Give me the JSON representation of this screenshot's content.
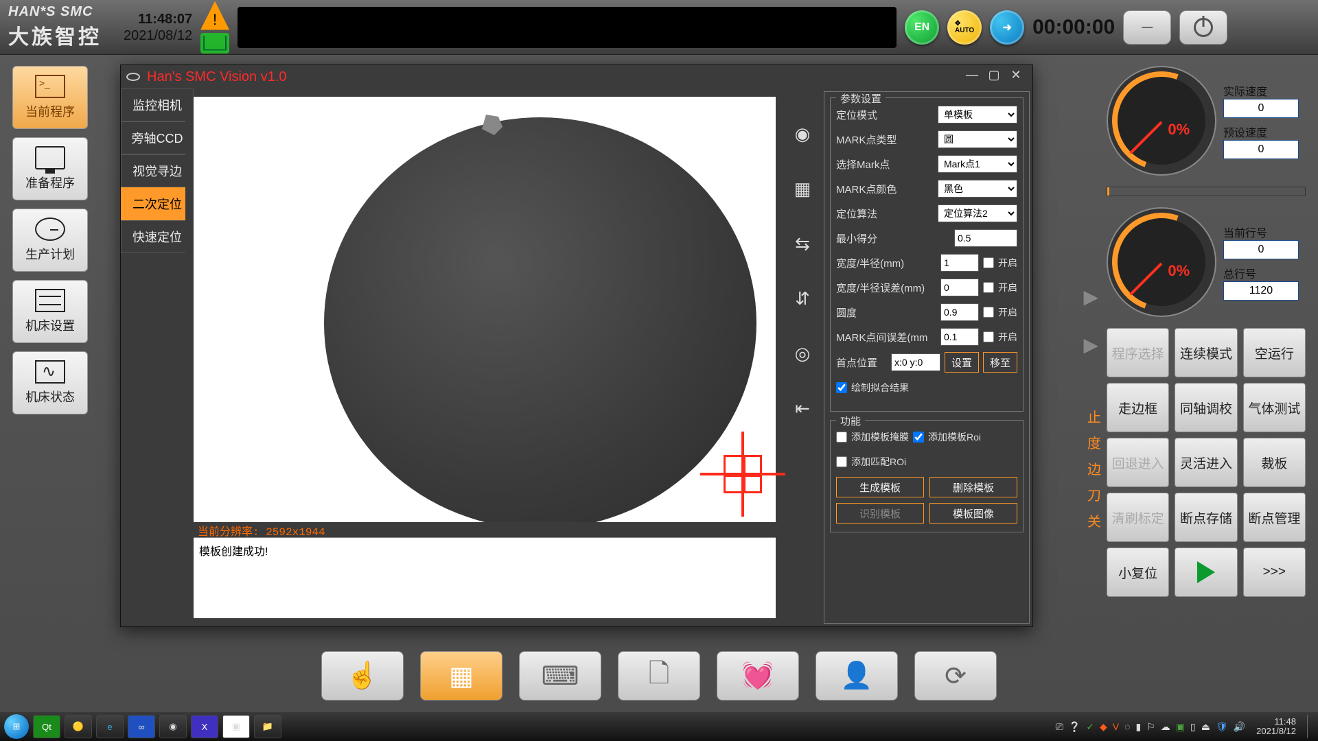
{
  "header": {
    "brand_en": "HAN*S SMC",
    "brand_cn": "大族智控",
    "time": "11:48:07",
    "date": "2021/08/12",
    "lang": "EN",
    "auto": "AUTO",
    "timer": "00:00:00"
  },
  "left_nav": [
    {
      "label": "当前程序",
      "active": true,
      "icon": "term"
    },
    {
      "label": "准备程序",
      "icon": "monitor"
    },
    {
      "label": "生产计划",
      "icon": "clock"
    },
    {
      "label": "机床设置",
      "icon": "sliders"
    },
    {
      "label": "机床状态",
      "icon": "wave"
    }
  ],
  "gauges": {
    "g1": {
      "pct": "0%",
      "fields": [
        {
          "lbl": "实际速度",
          "val": "0"
        },
        {
          "lbl": "预设速度",
          "val": "0"
        }
      ]
    },
    "g2": {
      "pct": "0%",
      "fields": [
        {
          "lbl": "当前行号",
          "val": "0"
        },
        {
          "lbl": "总行号",
          "val": "1120"
        }
      ]
    }
  },
  "btn_grid": [
    "程序选择",
    "连续模式",
    "空运行",
    "走边框",
    "同轴调校",
    "气体测试",
    "回退进入",
    "灵活进入",
    "裁板",
    "清刷标定",
    "断点存储",
    "断点管理",
    "小复位",
    "PLAY",
    ">>>"
  ],
  "btn_grid_disabled": [
    0,
    6,
    9
  ],
  "vision": {
    "title": "Han's SMC Vision v1.0",
    "tabs": [
      "监控相机",
      "旁轴CCD",
      "视觉寻边",
      "二次定位",
      "快速定位"
    ],
    "active_tab": 3,
    "resolution_label": "当前分辨率: 2592x1944",
    "log": "模板创建成功!",
    "params": {
      "legend": "参数设置",
      "locate_mode": {
        "lbl": "定位模式",
        "val": "单模板"
      },
      "mark_type": {
        "lbl": "MARK点类型",
        "val": "圆"
      },
      "mark_select": {
        "lbl": "选择Mark点",
        "val": "Mark点1"
      },
      "mark_color": {
        "lbl": "MARK点颜色",
        "val": "黑色"
      },
      "algo": {
        "lbl": "定位算法",
        "val": "定位算法2"
      },
      "min_score": {
        "lbl": "最小得分",
        "val": "0.5"
      },
      "width": {
        "lbl": "宽度/半径(mm)",
        "val": "1",
        "enable": "开启"
      },
      "width_err": {
        "lbl": "宽度/半径误差(mm)",
        "val": "0",
        "enable": "开启"
      },
      "roundness": {
        "lbl": "圆度",
        "val": "0.9",
        "enable": "开启"
      },
      "mark_dist_err": {
        "lbl": "MARK点间误差(mm",
        "val": "0.1",
        "enable": "开启"
      },
      "first_pt": {
        "lbl": "首点位置",
        "val": "x:0 y:0",
        "set": "设置",
        "move": "移至"
      },
      "draw_fit": {
        "lbl": "绘制拟合结果"
      }
    },
    "funcs": {
      "legend": "功能",
      "add_mask": "添加模板掩膜",
      "add_roi": "添加模板Roi",
      "add_match_roi": "添加匹配ROi",
      "gen": "生成模板",
      "del": "删除模板",
      "recog": "识别模板",
      "img": "模板图像"
    }
  },
  "bg_list": [
    "止",
    "度",
    "边",
    "刀",
    "关"
  ],
  "dock": [
    "☝",
    "▦",
    "⌨",
    "🗋",
    "💓",
    "👤",
    "⟳"
  ],
  "dock_active": 1,
  "taskbar": {
    "clock": "11:48",
    "date": "2021/8/12"
  }
}
